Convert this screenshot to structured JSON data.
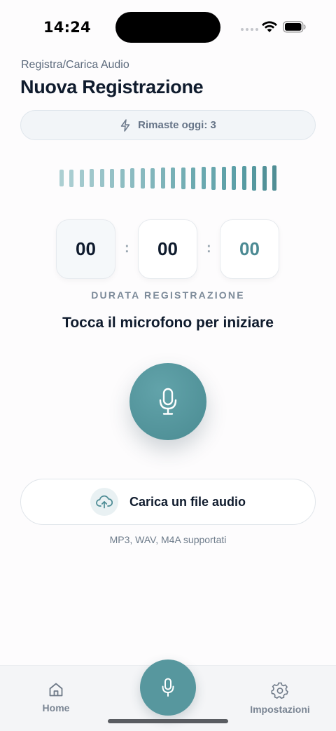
{
  "status_bar": {
    "time": "14:24"
  },
  "header": {
    "subtitle": "Registra/Carica Audio",
    "title": "Nuova Registrazione"
  },
  "remaining": {
    "icon": "lightning-icon",
    "label": "Rimaste oggi: 3"
  },
  "waveform": {
    "bar_count": 22
  },
  "timer": {
    "hours": "00",
    "minutes": "00",
    "seconds": "00",
    "separator": ":",
    "label": "DURATA REGISTRAZIONE"
  },
  "instruction": "Tocca il microfono per iniziare",
  "record_button": {
    "icon": "microphone-icon"
  },
  "upload": {
    "icon": "cloud-upload-icon",
    "label": "Carica un file audio",
    "formats": "MP3, WAV, M4A supportati"
  },
  "tab_bar": {
    "home_label": "Home",
    "settings_label": "Impostazioni",
    "center_icon": "microphone-icon"
  },
  "colors": {
    "accent": "#57979e",
    "title": "#0f1b2d",
    "muted": "#7a8593"
  }
}
